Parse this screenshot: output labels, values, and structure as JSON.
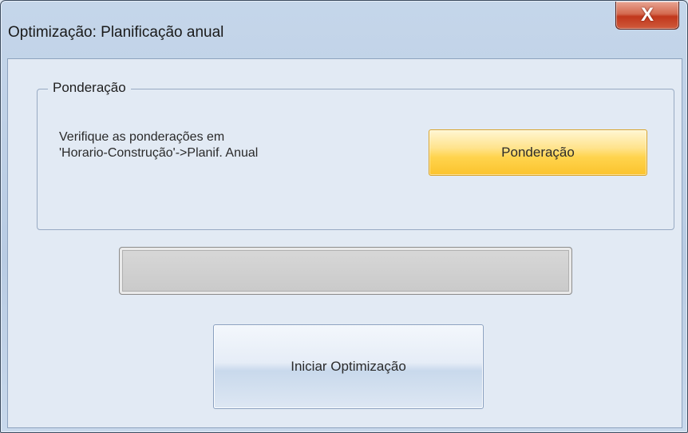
{
  "window": {
    "title": "Optimização: Planificação anual",
    "close_label": "X"
  },
  "weighting_group": {
    "legend": "Ponderação",
    "instructions_line1": "Verifique as ponderações em",
    "instructions_line2": "'Horario-Construção'->Planif. Anual",
    "button_label": "Ponderação"
  },
  "progress": {
    "value": 0
  },
  "start_button": {
    "label": "Iniciar Optimização"
  },
  "colors": {
    "accent_button": "#ffd44e",
    "window_frame": "#c5d6ea",
    "close_button": "#c1371c"
  }
}
